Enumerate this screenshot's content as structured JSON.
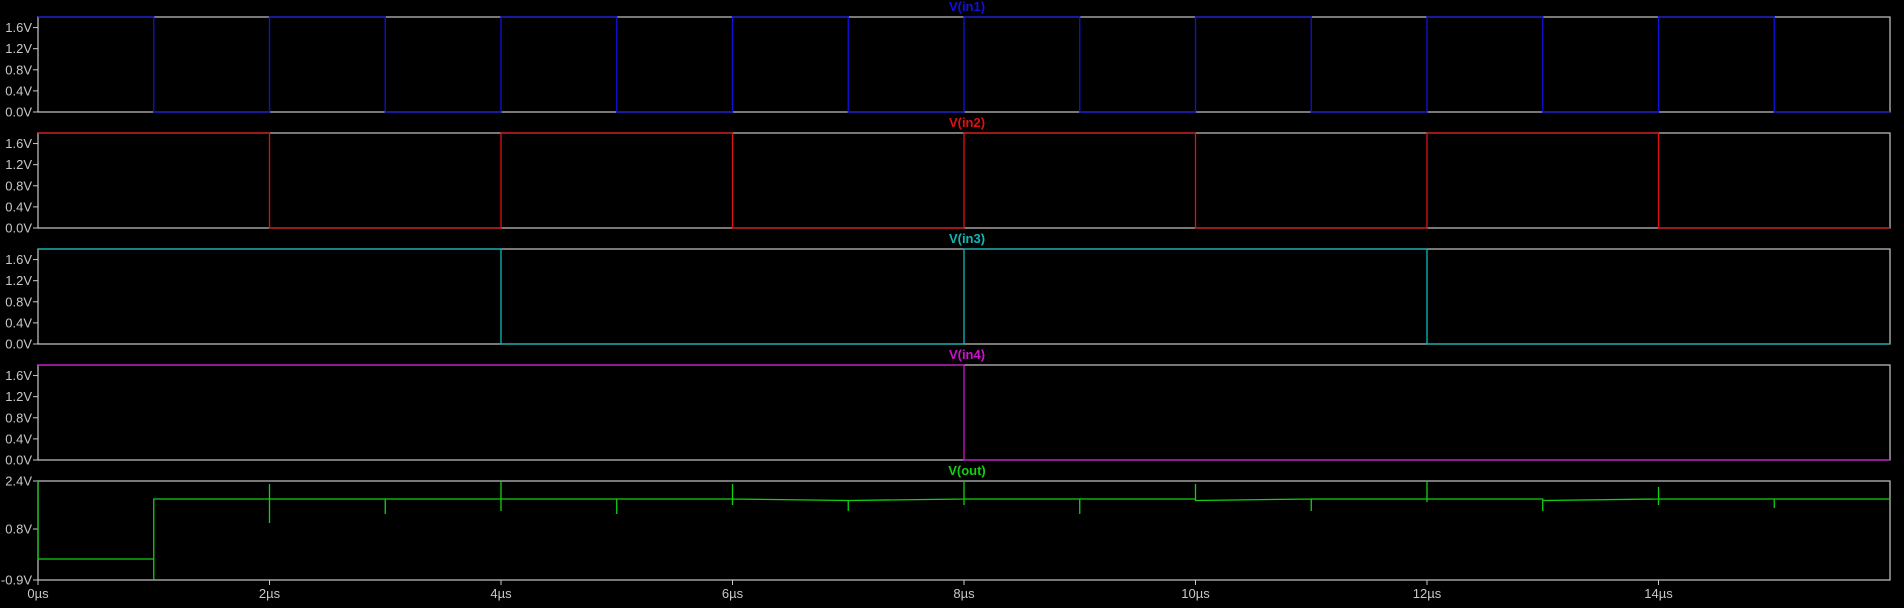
{
  "chart_data": [
    {
      "type": "line",
      "title": "V(in1)",
      "color": "#1010e0",
      "xlim": [
        0,
        16
      ],
      "ylim": [
        0,
        1.8
      ],
      "yticks": [
        {
          "value": 0,
          "label": "0.0V"
        },
        {
          "value": 0.4,
          "label": "0.4V"
        },
        {
          "value": 0.8,
          "label": "0.8V"
        },
        {
          "value": 1.2,
          "label": "1.2V"
        },
        {
          "value": 1.6,
          "label": "1.6V"
        }
      ],
      "series": [
        {
          "x": [
            0,
            1,
            1,
            2,
            2,
            3,
            3,
            4,
            4,
            5,
            5,
            6,
            6,
            7,
            7,
            8,
            8,
            9,
            9,
            10,
            10,
            11,
            11,
            12,
            12,
            13,
            13,
            14,
            14,
            15,
            15,
            16
          ],
          "values": [
            1.8,
            1.8,
            0,
            0,
            1.8,
            1.8,
            0,
            0,
            1.8,
            1.8,
            0,
            0,
            1.8,
            1.8,
            0,
            0,
            1.8,
            1.8,
            0,
            0,
            1.8,
            1.8,
            0,
            0,
            1.8,
            1.8,
            0,
            0,
            1.8,
            1.8,
            0,
            0
          ]
        }
      ]
    },
    {
      "type": "line",
      "title": "V(in2)",
      "color": "#e01010",
      "xlim": [
        0,
        16
      ],
      "ylim": [
        0,
        1.8
      ],
      "yticks": [
        {
          "value": 0,
          "label": "0.0V"
        },
        {
          "value": 0.4,
          "label": "0.4V"
        },
        {
          "value": 0.8,
          "label": "0.8V"
        },
        {
          "value": 1.2,
          "label": "1.2V"
        },
        {
          "value": 1.6,
          "label": "1.6V"
        }
      ],
      "series": [
        {
          "x": [
            0,
            2,
            2,
            4,
            4,
            6,
            6,
            8,
            8,
            10,
            10,
            12,
            12,
            14,
            14,
            16
          ],
          "values": [
            1.8,
            1.8,
            0,
            0,
            1.8,
            1.8,
            0,
            0,
            1.8,
            1.8,
            0,
            0,
            1.8,
            1.8,
            0,
            0
          ]
        }
      ]
    },
    {
      "type": "line",
      "title": "V(in3)",
      "color": "#10b8b8",
      "xlim": [
        0,
        16
      ],
      "ylim": [
        0,
        1.8
      ],
      "yticks": [
        {
          "value": 0,
          "label": "0.0V"
        },
        {
          "value": 0.4,
          "label": "0.4V"
        },
        {
          "value": 0.8,
          "label": "0.8V"
        },
        {
          "value": 1.2,
          "label": "1.2V"
        },
        {
          "value": 1.6,
          "label": "1.6V"
        }
      ],
      "series": [
        {
          "x": [
            0,
            4,
            4,
            8,
            8,
            12,
            12,
            16
          ],
          "values": [
            1.8,
            1.8,
            0,
            0,
            1.8,
            1.8,
            0,
            0
          ]
        }
      ]
    },
    {
      "type": "line",
      "title": "V(in4)",
      "color": "#d010d0",
      "xlim": [
        0,
        16
      ],
      "ylim": [
        0,
        1.8
      ],
      "yticks": [
        {
          "value": 0,
          "label": "0.0V"
        },
        {
          "value": 0.4,
          "label": "0.4V"
        },
        {
          "value": 0.8,
          "label": "0.8V"
        },
        {
          "value": 1.2,
          "label": "1.2V"
        },
        {
          "value": 1.6,
          "label": "1.6V"
        }
      ],
      "series": [
        {
          "x": [
            0,
            8,
            8,
            16
          ],
          "values": [
            1.8,
            1.8,
            0,
            0
          ]
        }
      ]
    },
    {
      "type": "line",
      "title": "V(out)",
      "color": "#10d010",
      "xlim": [
        0,
        16
      ],
      "ylim": [
        -0.9,
        2.4
      ],
      "yticks": [
        {
          "value": -0.9,
          "label": "-0.9V"
        },
        {
          "value": 0.8,
          "label": "0.8V"
        },
        {
          "value": 2.4,
          "label": "2.4V"
        }
      ],
      "xticks": [
        {
          "value": 0,
          "label": "0µs"
        },
        {
          "value": 2,
          "label": "2µs"
        },
        {
          "value": 4,
          "label": "4µs"
        },
        {
          "value": 6,
          "label": "6µs"
        },
        {
          "value": 8,
          "label": "8µs"
        },
        {
          "value": 10,
          "label": "10µs"
        },
        {
          "value": 12,
          "label": "12µs"
        },
        {
          "value": 14,
          "label": "14µs"
        }
      ],
      "series": [
        {
          "x": [
            0,
            0,
            0,
            1,
            1,
            1,
            1,
            2,
            2,
            2,
            2,
            3,
            3,
            3,
            4,
            4,
            4,
            4,
            5,
            5,
            5,
            6,
            6,
            6,
            6,
            7,
            7,
            7,
            8,
            8,
            8,
            8,
            9,
            9,
            9,
            10,
            10,
            10,
            10,
            11,
            11,
            11,
            12,
            12,
            12,
            12,
            13,
            13,
            13,
            14,
            14,
            14,
            14,
            15,
            15,
            15,
            16
          ],
          "values": [
            2.4,
            -0.2,
            -0.2,
            -0.2,
            -0.9,
            1.8,
            1.8,
            1.8,
            2.3,
            1.0,
            1.8,
            1.8,
            1.3,
            1.8,
            1.8,
            2.4,
            1.4,
            1.8,
            1.8,
            1.3,
            1.8,
            1.8,
            2.3,
            1.6,
            1.8,
            1.75,
            1.4,
            1.75,
            1.8,
            2.4,
            1.6,
            1.8,
            1.8,
            1.3,
            1.8,
            1.8,
            2.3,
            1.75,
            1.75,
            1.8,
            1.4,
            1.8,
            1.8,
            2.4,
            1.7,
            1.8,
            1.8,
            1.4,
            1.75,
            1.8,
            2.2,
            1.6,
            1.8,
            1.8,
            1.5,
            1.8,
            1.8
          ]
        }
      ]
    }
  ]
}
